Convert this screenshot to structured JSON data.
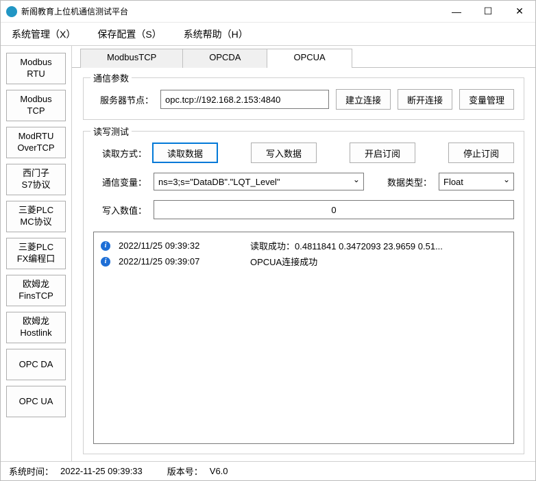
{
  "window": {
    "title": "新阁教育上位机通信测试平台"
  },
  "menubar": {
    "items": [
      "系统管理（X）",
      "保存配置（S）",
      "系统帮助（H）"
    ]
  },
  "sidebar": {
    "items": [
      "Modbus\nRTU",
      "Modbus\nTCP",
      "ModRTU\nOverTCP",
      "西门子\nS7协议",
      "三菱PLC\nMC协议",
      "三菱PLC\nFX编程口",
      "欧姆龙\nFinsTCP",
      "欧姆龙\nHostlink",
      "OPC DA",
      "OPC UA"
    ]
  },
  "tabs": {
    "items": [
      "ModbusTCP",
      "OPCDA",
      "OPCUA"
    ],
    "active": 2
  },
  "comm_params": {
    "title": "通信参数",
    "server_label": "服务器节点：",
    "server_value": "opc.tcp://192.168.2.153:4840",
    "connect_btn": "建立连接",
    "disconnect_btn": "断开连接",
    "varmgmt_btn": "变量管理"
  },
  "rw_test": {
    "title": "读写测试",
    "read_mode_label": "读取方式：",
    "read_btn": "读取数据",
    "write_btn": "写入数据",
    "sub_btn": "开启订阅",
    "unsub_btn": "停止订阅",
    "var_label": "通信变量：",
    "var_value": "ns=3;s=\"DataDB\".\"LQT_Level\"",
    "datatype_label": "数据类型：",
    "datatype_value": "Float",
    "writeval_label": "写入数值：",
    "writeval_value": "0"
  },
  "log": {
    "entries": [
      {
        "time": "2022/11/25 09:39:32",
        "msg": "读取成功：0.4811841 0.3472093 23.9659 0.51..."
      },
      {
        "time": "2022/11/25 09:39:07",
        "msg": "OPCUA连接成功"
      }
    ]
  },
  "statusbar": {
    "systime_label": "系统时间：",
    "systime_value": "2022-11-25 09:39:33",
    "version_label": "版本号：",
    "version_value": "V6.0"
  }
}
